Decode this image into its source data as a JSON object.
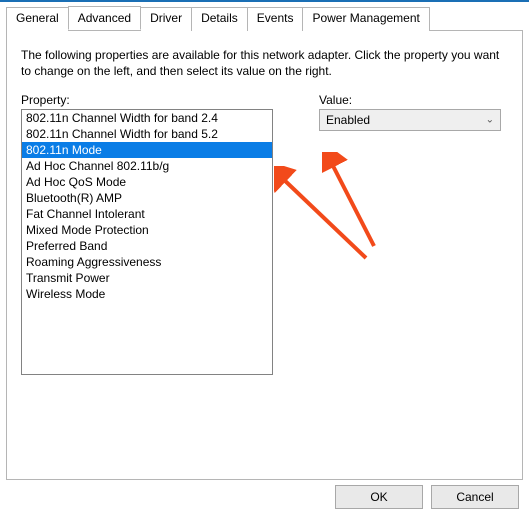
{
  "tabs": {
    "items": [
      {
        "label": "General"
      },
      {
        "label": "Advanced"
      },
      {
        "label": "Driver"
      },
      {
        "label": "Details"
      },
      {
        "label": "Events"
      },
      {
        "label": "Power Management"
      }
    ],
    "active_index": 1
  },
  "panel": {
    "description": "The following properties are available for this network adapter. Click the property you want to change on the left, and then select its value on the right.",
    "property_label": "Property:",
    "value_label": "Value:"
  },
  "property_list": {
    "items": [
      "802.11n Channel Width for band 2.4",
      "802.11n Channel Width for band 5.2",
      "802.11n Mode",
      "Ad Hoc Channel 802.11b/g",
      "Ad Hoc QoS Mode",
      "Bluetooth(R) AMP",
      "Fat Channel Intolerant",
      "Mixed Mode Protection",
      "Preferred Band",
      "Roaming Aggressiveness",
      "Transmit Power",
      "Wireless Mode"
    ],
    "selected_index": 2
  },
  "value_select": {
    "selected": "Enabled"
  },
  "buttons": {
    "ok": "OK",
    "cancel": "Cancel"
  },
  "annotation_color": "#f24a1a"
}
